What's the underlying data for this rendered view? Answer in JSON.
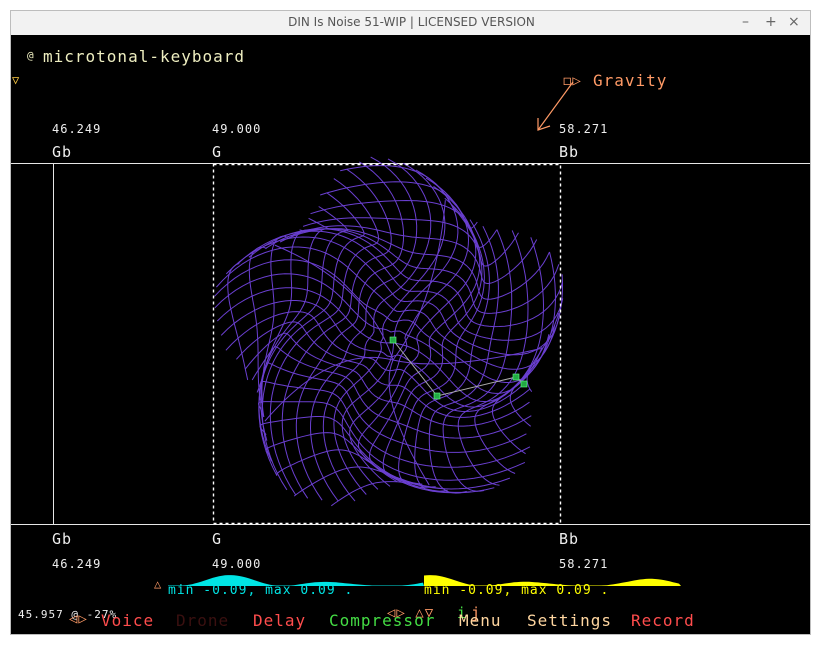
{
  "window": {
    "title": "DIN Is Noise 51-WIP | LICENSED VERSION",
    "controls": [
      "–",
      "+",
      "×"
    ]
  },
  "header": {
    "instrument_prefix": "@",
    "instrument_name": "microtonal-keyboard",
    "collapse_glyph": "▽",
    "gravity_glyph": "◻▷",
    "gravity_label": "Gravity"
  },
  "top_ruler": {
    "values": [
      "46.249",
      "49.000",
      "58.271"
    ],
    "notes": [
      "Gb",
      "G",
      "Bb"
    ]
  },
  "bottom_ruler": {
    "notes": [
      "Gb",
      "G",
      "Bb"
    ],
    "values": [
      "46.249",
      "49.000",
      "58.271"
    ]
  },
  "levels": {
    "arrow": "△",
    "left_text": "min -0.09, max 0.09 .",
    "right_text": "min -0.09, max 0.09 .",
    "left_color": "#00e5e5",
    "right_color": "#ffff00"
  },
  "status": {
    "readout": "45.957 @ -27%",
    "nav_glyphs": "◁▷ △▽",
    "key_i": "i",
    "key_j": "j"
  },
  "menu": {
    "arrows": "◁▷",
    "items": [
      {
        "label": "Voice",
        "color": "#ff4d4d"
      },
      {
        "label": "Drone",
        "color": "#3a1010"
      },
      {
        "label": "Delay",
        "color": "#ff4d4d"
      },
      {
        "label": "Compressor",
        "color": "#44dd44"
      },
      {
        "label": "Menu",
        "color": "#ffd6a0"
      },
      {
        "label": "Settings",
        "color": "#ffd6a0"
      },
      {
        "label": "Record",
        "color": "#ff4d4d"
      }
    ]
  },
  "colors": {
    "mesh": "#6a3fd0",
    "handle": "#22aa44",
    "gravity": "#ff9a66",
    "selection": "#ffffff"
  }
}
